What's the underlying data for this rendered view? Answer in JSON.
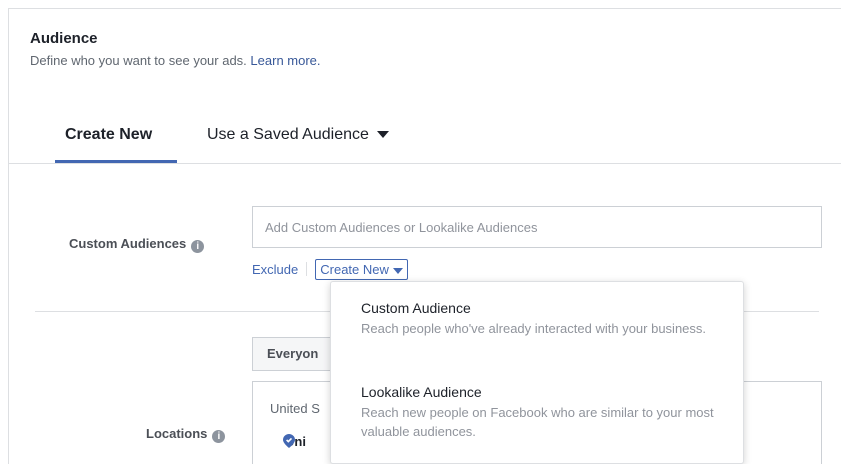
{
  "header": {
    "title": "Audience",
    "subtitle": "Define who you want to see your ads.",
    "learn_more": "Learn more."
  },
  "tabs": {
    "create_new": "Create New",
    "saved": "Use a Saved Audience"
  },
  "custom_audiences": {
    "label": "Custom Audiences",
    "placeholder": "Add Custom Audiences or Lookalike Audiences",
    "exclude": "Exclude",
    "create_new": "Create New"
  },
  "dropdown": {
    "items": [
      {
        "title": "Custom Audience",
        "description": "Reach people who've already interacted with your business."
      },
      {
        "title": "Lookalike Audience",
        "description": "Reach new people on Facebook who are similar to your most valuable audiences."
      }
    ]
  },
  "locations": {
    "label": "Locations",
    "everyone": "Everyon",
    "header": "United S",
    "item": "Uni"
  },
  "colors": {
    "accent": "#4267b2",
    "link": "#385898"
  },
  "icons": {
    "info": "info-icon",
    "caret": "caret-down-icon",
    "pin": "location-pin-icon"
  }
}
